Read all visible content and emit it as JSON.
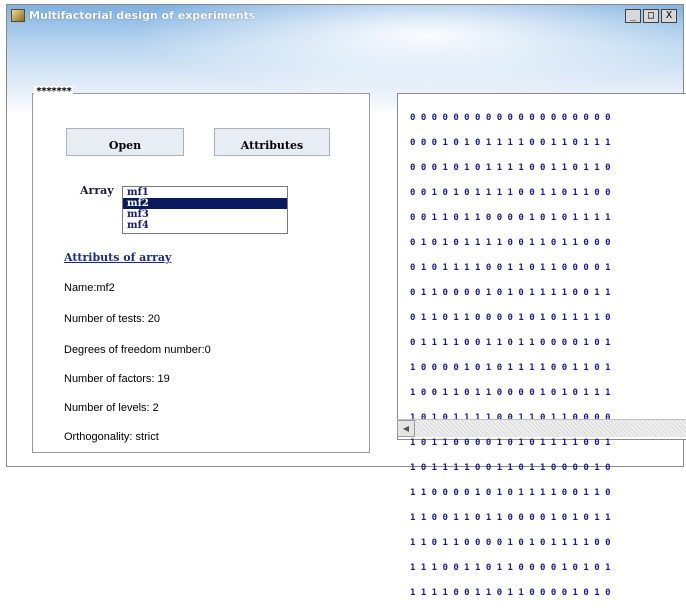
{
  "window": {
    "title": "Multifactorial design of experiments",
    "controls": {
      "minimize": "_",
      "maximize": "□",
      "close": "X"
    }
  },
  "group_caption": "*******",
  "buttons": {
    "open": "Open",
    "attributes": "Attributes"
  },
  "array": {
    "label": "Array",
    "items": [
      "mf1",
      "mf2",
      "mf3",
      "mf4"
    ],
    "selected": "mf2"
  },
  "attributes": {
    "heading": "Attributs of array",
    "lines": [
      "Name:mf2",
      "Number of tests: 20",
      "Degrees of freedom number:0",
      "Number of factors: 19",
      "Number of levels: 2",
      "Orthogonality: strict"
    ]
  },
  "matrix": {
    "rows": [
      "0 0 0 0 0 0 0 0 0 0 0 0 0 0 0 0 0 0 0",
      "0 0 0 1 0 1 0 1 1 1 1 0 0 1 1 0 1 1 1",
      "0 0 0 1 0 1 0 1 1 1 1 0 0 1 1 0 1 1 0",
      "0 0 1 0 1 0 1 1 1 1 0 0 1 1 0 1 1 0 0",
      "0 0 1 1 0 1 1 0 0 0 0 1 0 1 0 1 1 1 1",
      "0 1 0 1 0 1 1 1 1 0 0 1 1 0 1 1 0 0 0",
      "0 1 0 1 1 1 1 0 0 1 1 0 1 1 0 0 0 0 1",
      "0 1 1 0 0 0 0 1 0 1 0 1 1 1 1 0 0 1 1",
      "0 1 1 0 1 1 0 0 0 0 1 0 1 0 1 1 1 1 0",
      "0 1 1 1 1 0 0 1 1 0 1 1 0 0 0 0 1 0 1",
      "1 0 0 0 0 1 0 1 0 1 1 1 1 0 0 1 1 0 1",
      "1 0 0 1 1 0 1 1 0 0 0 0 1 0 1 0 1 1 1",
      "1 0 1 0 1 1 1 1 0 0 1 1 0 1 1 0 0 0 0",
      "1 0 1 1 0 0 0 0 1 0 1 0 1 1 1 1 0 0 1",
      "1 0 1 1 1 1 0 0 1 1 0 1 1 0 0 0 0 1 0",
      "1 1 0 0 0 0 1 0 1 0 1 1 1 1 0 0 1 1 0",
      "1 1 0 0 1 1 0 1 1 0 0 0 0 1 0 1 0 1 1",
      "1 1 0 1 1 0 0 0 0 1 0 1 0 1 1 1 1 0 0",
      "1 1 1 0 0 1 1 0 1 1 0 0 0 0 1 0 1 0 1",
      "1 1 1 1 0 0 1 1 0 1 1 0 0 0 0 1 0 1 0"
    ]
  },
  "colors": {
    "matrix_text": "#1a1a8a",
    "selection": "#0a1a5c",
    "link": "#1b2a8a"
  },
  "icons": {
    "app": "app-icon",
    "scroll_left": "scroll-left-arrow-icon"
  }
}
